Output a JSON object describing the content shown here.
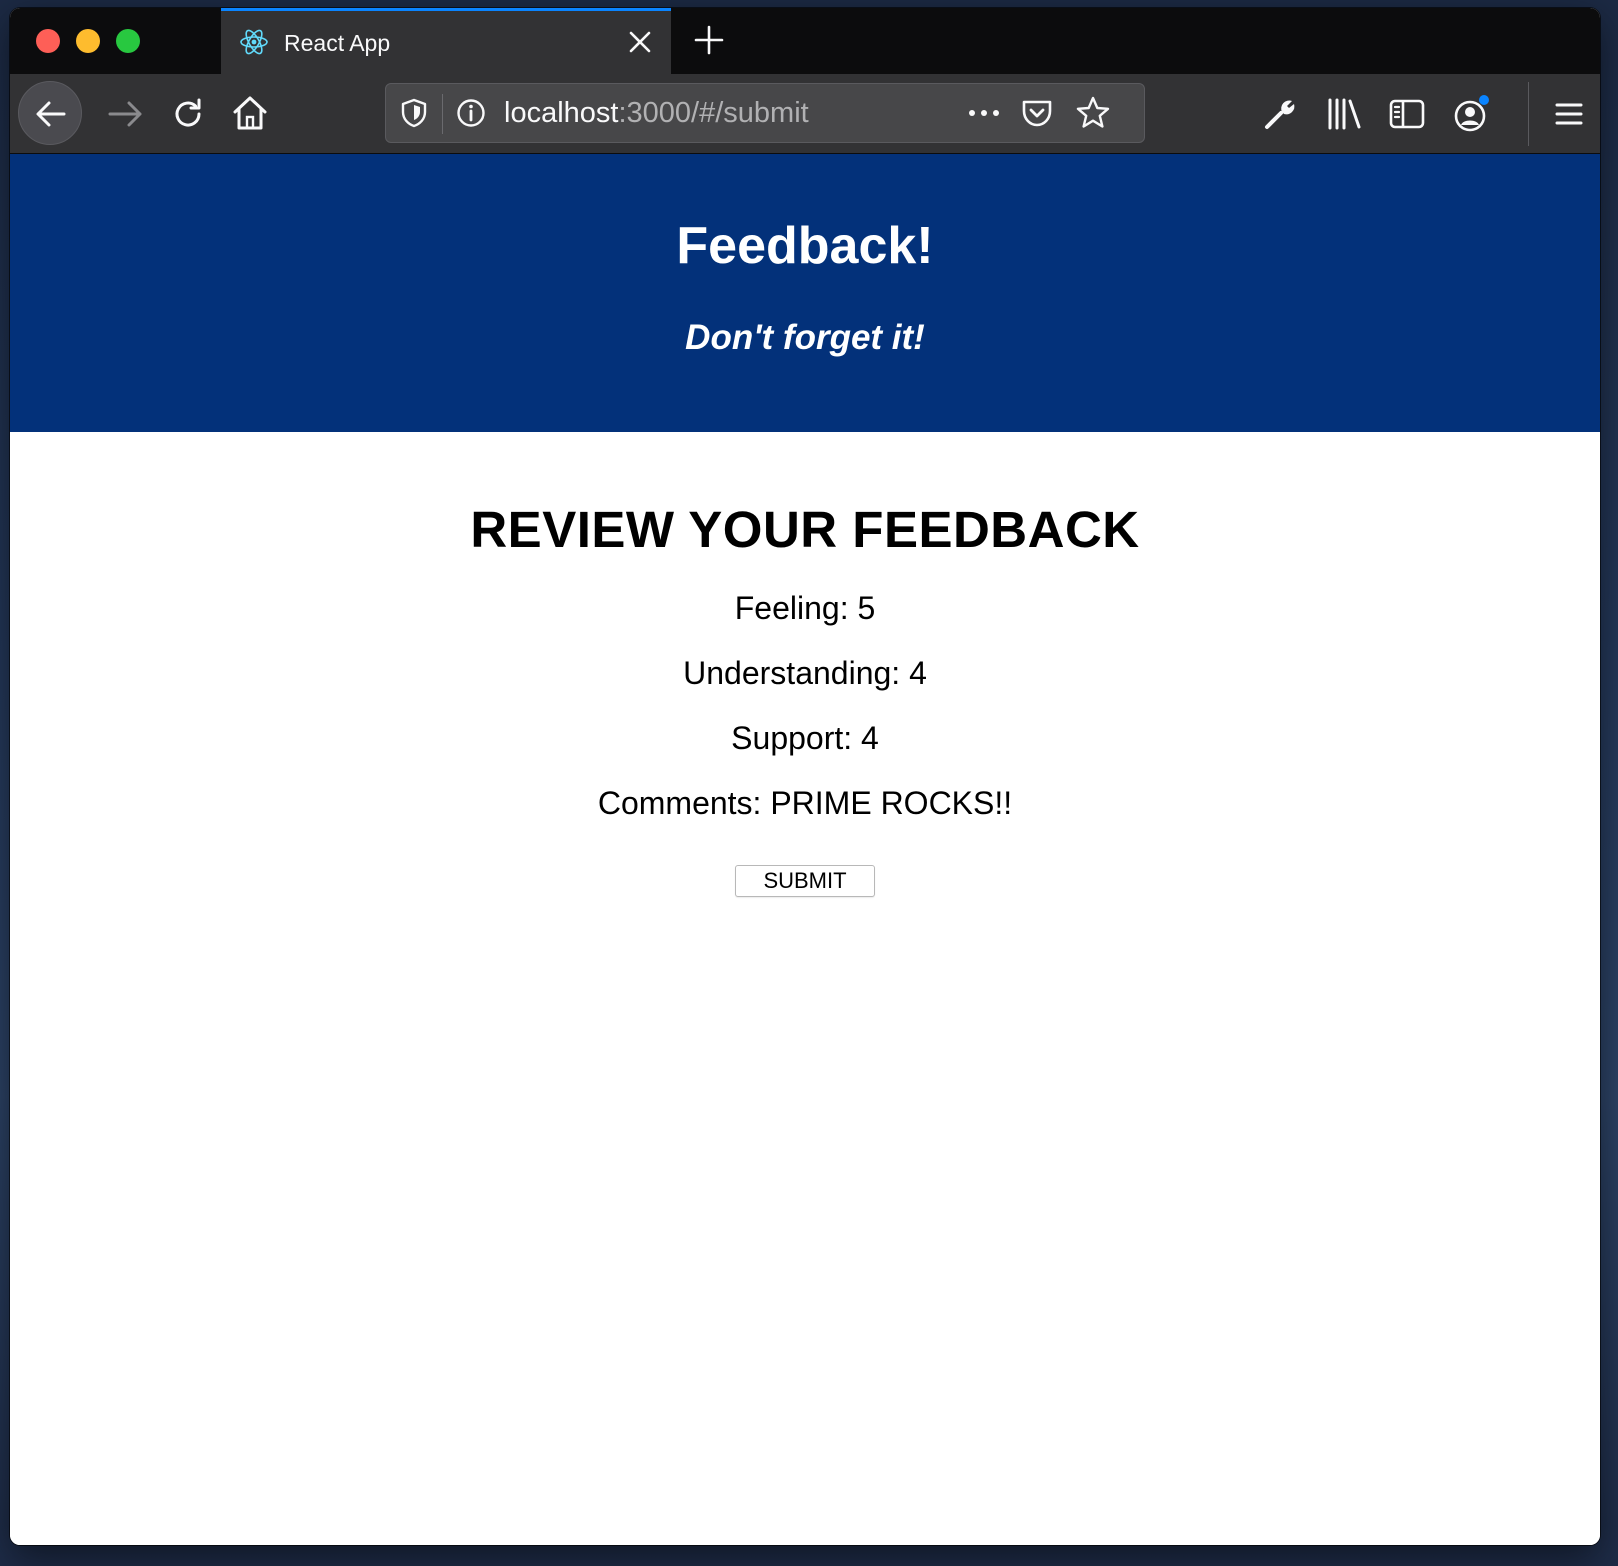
{
  "browser": {
    "tab": {
      "title": "React App",
      "favicon": "react-atom-icon",
      "accent": "#0a84ff"
    },
    "url": {
      "host": "localhost",
      "rest": ":3000/#/submit"
    },
    "chrome_color": "#323234",
    "tabstrip_color": "#0c0c0d"
  },
  "header": {
    "title": "Feedback!",
    "subtitle": "Don't forget it!",
    "background": "#03317a"
  },
  "review": {
    "heading": "REVIEW YOUR FEEDBACK",
    "lines": [
      "Feeling: 5",
      "Understanding: 4",
      "Support: 4",
      "Comments: PRIME ROCKS!!"
    ],
    "submit_label": "SUBMIT"
  }
}
